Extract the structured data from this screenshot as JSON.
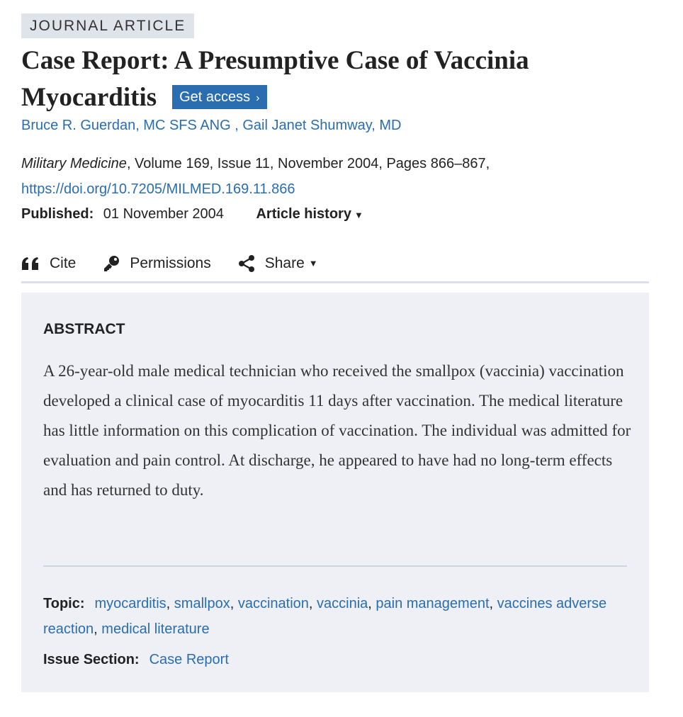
{
  "badge": "JOURNAL ARTICLE",
  "title": "Case Report: A Presumptive Case of Vaccinia Myocarditis",
  "access_button": "Get access",
  "authors": [
    "Bruce R. Guerdan, MC SFS ANG",
    "Gail Janet Shumway, MD"
  ],
  "citation": {
    "journal": "Military Medicine",
    "details": ", Volume 169, Issue 11, November 2004, Pages 866–867,",
    "doi": "https://doi.org/10.7205/MILMED.169.11.866"
  },
  "published": {
    "label": "Published:",
    "date": "01 November 2004",
    "history": "Article history"
  },
  "tools": {
    "cite": "Cite",
    "permissions": "Permissions",
    "share": "Share"
  },
  "abstract": {
    "heading": "ABSTRACT",
    "text": "A 26-year-old male medical technician who received the smallpox (vaccinia) vaccination developed a clinical case of myocarditis 11 days after vaccination. The medical literature has little information on this complication of vaccination. The individual was admitted for evaluation and pain control. At discharge, he appeared to have had no long-term effects and has returned to duty."
  },
  "topic": {
    "label": "Topic:",
    "items": [
      "myocarditis",
      "smallpox",
      "vaccination",
      "vaccinia",
      "pain management",
      "vaccines adverse reaction",
      "medical literature"
    ]
  },
  "issue_section": {
    "label": "Issue Section:",
    "value": "Case Report"
  }
}
